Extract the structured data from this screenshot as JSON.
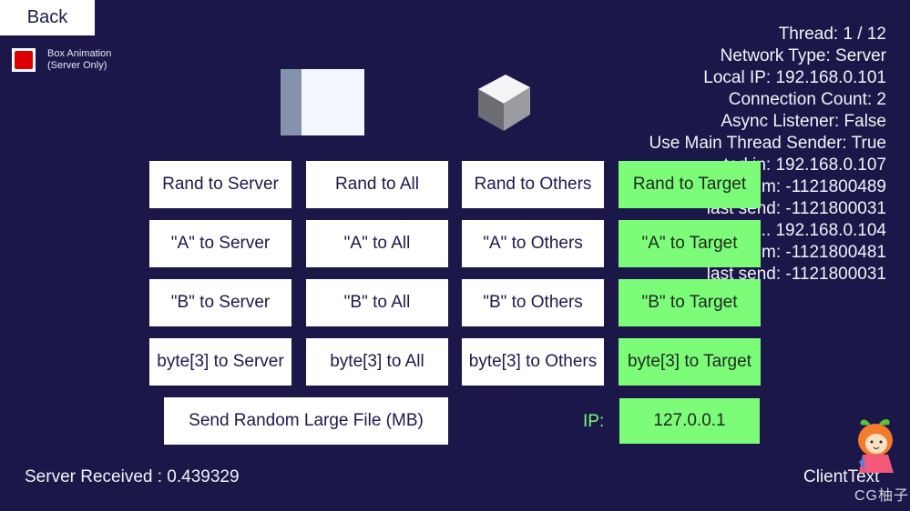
{
  "back_button": {
    "label": "Back"
  },
  "box_animation": {
    "label_line1": "Box Animation",
    "label_line2": "(Server Only)",
    "checked": true,
    "color": "#dd0000"
  },
  "status": {
    "lines": [
      "Thread: 1 / 12",
      "Network Type: Server",
      "Local IP: 192.168.0.101",
      "Connection Count: 2",
      "Async Listener: False",
      "Use Main Thread Sender: True",
      "...ted in: 192.168.0.107",
      "...m: -1121800489",
      "last send: -1121800031",
      "... 192.168.0.104",
      "...m: -1121800481",
      "last send: -1121800031"
    ]
  },
  "buttons": {
    "rows": [
      [
        "Rand to Server",
        "Rand to All",
        "Rand to Others",
        "Rand to Target"
      ],
      [
        "\"A\" to Server",
        "\"A\" to All",
        "\"A\" to Others",
        "\"A\" to Target"
      ],
      [
        "\"B\" to Server",
        "\"B\" to All",
        "\"B\" to Others",
        "\"B\" to Target"
      ],
      [
        "byte[3] to Server",
        "byte[3] to All",
        "byte[3] to Others",
        "byte[3] to Target"
      ]
    ],
    "large_file": "Send Random Large File (MB)"
  },
  "ip_input": {
    "label": "IP:",
    "value": "127.0.0.1"
  },
  "footer": {
    "server_received": "Server Received : 0.439329",
    "client_text": "ClientText"
  },
  "watermark": "CG柚子",
  "colors": {
    "background": "#1b1849",
    "target_button": "#7dfc7a",
    "button": "#ffffff",
    "text_dark": "#1c1a4a"
  }
}
